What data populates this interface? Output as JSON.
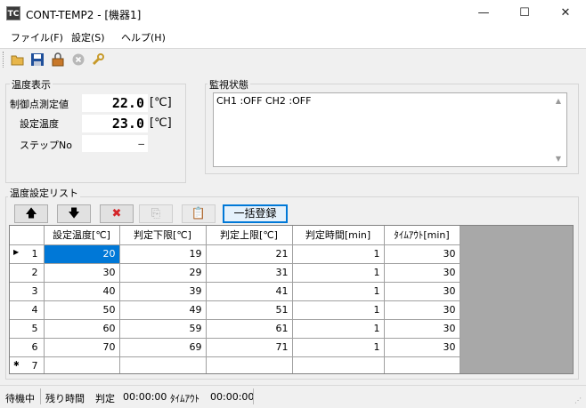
{
  "window": {
    "title": "CONT-TEMP2 - [機器1]",
    "icon_text": "TC",
    "minimize": "—",
    "maximize": "☐",
    "close": "✕"
  },
  "menu": [
    {
      "label": "ファイル(F)"
    },
    {
      "label": "設定(S)"
    },
    {
      "label": "ヘルプ(H)"
    }
  ],
  "toolbar": {
    "icons": [
      "open-folder-icon",
      "save-icon",
      "lock-icon",
      "stop-icon",
      "wrench-icon"
    ]
  },
  "temp_display": {
    "group_title": "温度表示",
    "measured_label": "制御点測定値",
    "measured_value": "22.0",
    "setpoint_label": "設定温度",
    "setpoint_value": "23.0",
    "unit": "[℃]",
    "step_label": "ステップNo",
    "step_value": "—"
  },
  "monitor": {
    "group_title": "監視状態",
    "text": "CH1 :OFF CH2 :OFF"
  },
  "temp_list": {
    "group_title": "温度設定リスト",
    "buttons": {
      "up": "🡅",
      "down": "🡇",
      "delete": "✖",
      "copy": "⎘",
      "paste": "📋",
      "bulk_register": "一括登録"
    },
    "columns": [
      "設定温度[℃]",
      "判定下限[℃]",
      "判定上限[℃]",
      "判定時間[min]",
      "ﾀｲﾑｱｳﾄ[min]"
    ],
    "rows": [
      {
        "no": "1",
        "cells": [
          "20",
          "19",
          "21",
          "1",
          "30"
        ]
      },
      {
        "no": "2",
        "cells": [
          "30",
          "29",
          "31",
          "1",
          "30"
        ]
      },
      {
        "no": "3",
        "cells": [
          "40",
          "39",
          "41",
          "1",
          "30"
        ]
      },
      {
        "no": "4",
        "cells": [
          "50",
          "49",
          "51",
          "1",
          "30"
        ]
      },
      {
        "no": "5",
        "cells": [
          "60",
          "59",
          "61",
          "1",
          "30"
        ]
      },
      {
        "no": "6",
        "cells": [
          "70",
          "69",
          "71",
          "1",
          "30"
        ]
      },
      {
        "no": "7",
        "cells": [
          "",
          "",
          "",
          "",
          ""
        ]
      }
    ],
    "current_row_marker": "▶",
    "new_row_marker": "✱"
  },
  "status": {
    "state": "待機中",
    "remaining_label": "残り時間",
    "judge_label": "判定",
    "judge_time": "00:00:00",
    "timeout_label": "ﾀｲﾑｱｳﾄ",
    "timeout_time": "00:00:00"
  }
}
